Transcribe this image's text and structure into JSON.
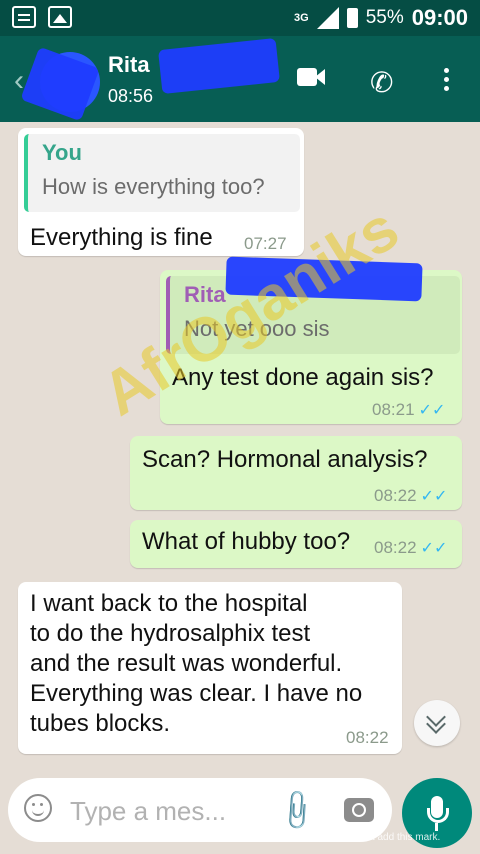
{
  "status_bar": {
    "network": "3G",
    "battery": "55%",
    "time": "09:00"
  },
  "header": {
    "contact_name": "Rita",
    "last_seen": "08:56"
  },
  "messages": [
    {
      "direction": "incoming",
      "quote_author": "You",
      "quote_text": "How is everything too?",
      "text": "Everything is fine",
      "time": "07:27"
    },
    {
      "direction": "outgoing",
      "quote_author": "Rita",
      "quote_text": "Not yet ooo sis",
      "text": "Any test done again sis?",
      "time": "08:21"
    },
    {
      "direction": "outgoing",
      "text": "Scan? Hormonal analysis?",
      "time": "08:22"
    },
    {
      "direction": "outgoing",
      "text": "What of hubby too?",
      "time": "08:22"
    },
    {
      "direction": "incoming",
      "lines": [
        "I want back to the hospital",
        "to do the hydrosalphix test",
        "and the result was wonderful.",
        "Everything was clear. I have no",
        "tubes blocks."
      ],
      "time": "08:22"
    }
  ],
  "composer": {
    "placeholder": "Type a mes..."
  },
  "watermark_text": "AfrOganiks",
  "footer_note": "Processed using the free version of Watermarkly. The paid version does not add this mark.",
  "colors": {
    "header": "#075e54",
    "status": "#054d44",
    "outgoing_bubble": "#dcf8c6",
    "incoming_bubble": "#ffffff",
    "read_tick": "#34b7f1",
    "mic_button": "#00897b"
  }
}
